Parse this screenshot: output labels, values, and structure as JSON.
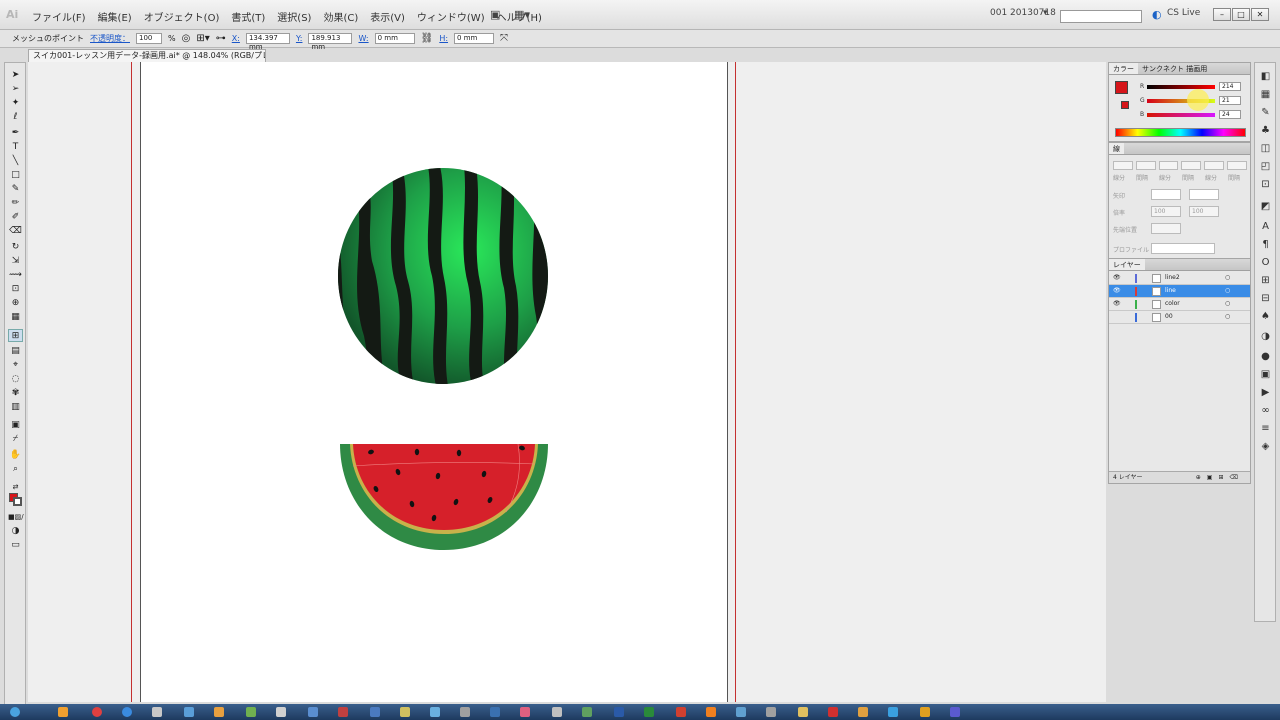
{
  "app": {
    "logo": "Ai"
  },
  "menu": [
    "ファイル(F)",
    "編集(E)",
    "オブジェクト(O)",
    "書式(T)",
    "選択(S)",
    "効果(C)",
    "表示(V)",
    "ウィンドウ(W)",
    "ヘルプ(H)"
  ],
  "menubar_right": {
    "workspace": "001 20130718",
    "cslive": "CS Live"
  },
  "control": {
    "object_label": "メッシュのポイント",
    "opacity_label": "不透明度：",
    "opacity_value": "100",
    "percent": "%",
    "x_label": "X:",
    "x_value": "134.397 mm",
    "y_label": "Y:",
    "y_value": "189.913 mm",
    "w_label": "W:",
    "w_value": "0 mm",
    "h_label": "H:",
    "h_value": "0 mm"
  },
  "document_tab": "スイカ001-レッスン用データ-録画用.ai* @ 148.04% (RGB/プレビュー)",
  "color_panel": {
    "tabs": [
      "カラー",
      "サンクネクト 描画用"
    ],
    "channels": [
      {
        "label": "R",
        "value": "214"
      },
      {
        "label": "G",
        "value": "21"
      },
      {
        "label": "B",
        "value": "24"
      }
    ],
    "fill_color": "#d6151a"
  },
  "stroke_panel": {
    "title": "線",
    "labels": [
      "線分",
      "間隔",
      "線分",
      "間隔",
      "線分",
      "間隔"
    ],
    "arrow_label": "矢印",
    "scale_label": "倍率",
    "scale_start": "100",
    "scale_end": "100",
    "align_label": "先端位置",
    "profile_label": "プロファイル"
  },
  "layers_panel": {
    "title": "レイヤー",
    "layers": [
      {
        "name": "line2",
        "color": "#5b6bd8",
        "selected": false
      },
      {
        "name": "line",
        "color": "#d83a3a",
        "selected": true
      },
      {
        "name": "color",
        "color": "#3ab04a",
        "selected": false
      },
      {
        "name": "00",
        "color": "#3a6bd8",
        "selected": false
      }
    ],
    "footer": "4 レイヤー"
  },
  "colors": {
    "melon_green": "#2a9d4a",
    "rind": "#2f8a45",
    "flesh": "#d6202a",
    "seed": "#1a1a1a"
  }
}
